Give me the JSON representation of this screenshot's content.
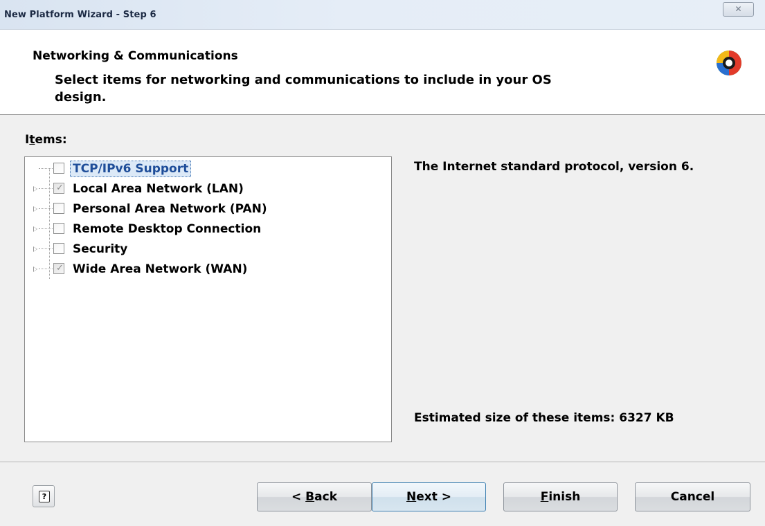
{
  "window": {
    "title": "New Platform Wizard - Step 6",
    "close_glyph": "✕"
  },
  "header": {
    "title": "Networking & Communications",
    "subtitle": "Select items for networking and communications to include in your OS design.",
    "logo_icon": "platform-builder-logo-icon"
  },
  "items": {
    "label_prefix": "I",
    "label_mnemonic": "t",
    "label_suffix": "ems:",
    "tree": [
      {
        "label": "TCP/IPv6 Support",
        "checked": false,
        "expandable": false,
        "selected": true
      },
      {
        "label": "Local Area Network (LAN)",
        "checked": true,
        "expandable": true,
        "selected": false
      },
      {
        "label": "Personal Area Network (PAN)",
        "checked": false,
        "expandable": true,
        "selected": false
      },
      {
        "label": "Remote Desktop Connection",
        "checked": false,
        "expandable": true,
        "selected": false
      },
      {
        "label": "Security",
        "checked": false,
        "expandable": true,
        "selected": false
      },
      {
        "label": "Wide Area Network (WAN)",
        "checked": true,
        "expandable": true,
        "selected": false
      }
    ]
  },
  "description": "The Internet standard protocol, version 6.",
  "estimated_size": "Estimated size of these items: 6327 KB",
  "buttons": {
    "help_glyph": "?",
    "back": {
      "pre": "< ",
      "mnemonic": "B",
      "post": "ack"
    },
    "next": {
      "pre": "",
      "mnemonic": "N",
      "post": "ext >"
    },
    "finish": {
      "pre": "",
      "mnemonic": "F",
      "post": "inish"
    },
    "cancel": {
      "label": "Cancel"
    }
  },
  "colors": {
    "selection_text": "#1e4d99",
    "selection_bg": "#dce9f7",
    "default_button_border": "#3c7fb1"
  }
}
